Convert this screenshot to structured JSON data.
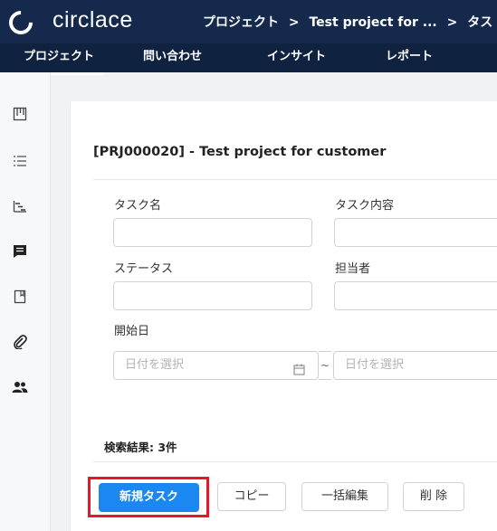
{
  "header": {
    "brand": "circlace",
    "breadcrumb": [
      "プロジェクト",
      ">",
      "Test project for ...",
      ">",
      "タス"
    ]
  },
  "nav": {
    "items": [
      {
        "label": "プロジェクト",
        "active": true
      },
      {
        "label": "問い合わせ"
      },
      {
        "label": "インサイト"
      },
      {
        "label": "レポート"
      }
    ]
  },
  "sidebar": {
    "icons": [
      "board-icon",
      "list-icon",
      "gantt-icon",
      "comment-icon",
      "bookmark-icon",
      "attachment-icon",
      "members-icon"
    ]
  },
  "page": {
    "title": "[PRJ000020] - Test project for customer"
  },
  "form": {
    "task_name_label": "タスク名",
    "task_content_label": "タスク内容",
    "status_label": "ステータス",
    "assignee_label": "担当者",
    "start_date_label": "開始日",
    "date_from_placeholder": "日付を選択",
    "date_to_placeholder": "日付を選択",
    "date_separator": "~"
  },
  "results": {
    "text": "検索結果: 3件"
  },
  "actions": {
    "new_task": "新規タスク",
    "copy": "コピー",
    "bulk_edit": "一括編集",
    "delete": "削 除"
  }
}
